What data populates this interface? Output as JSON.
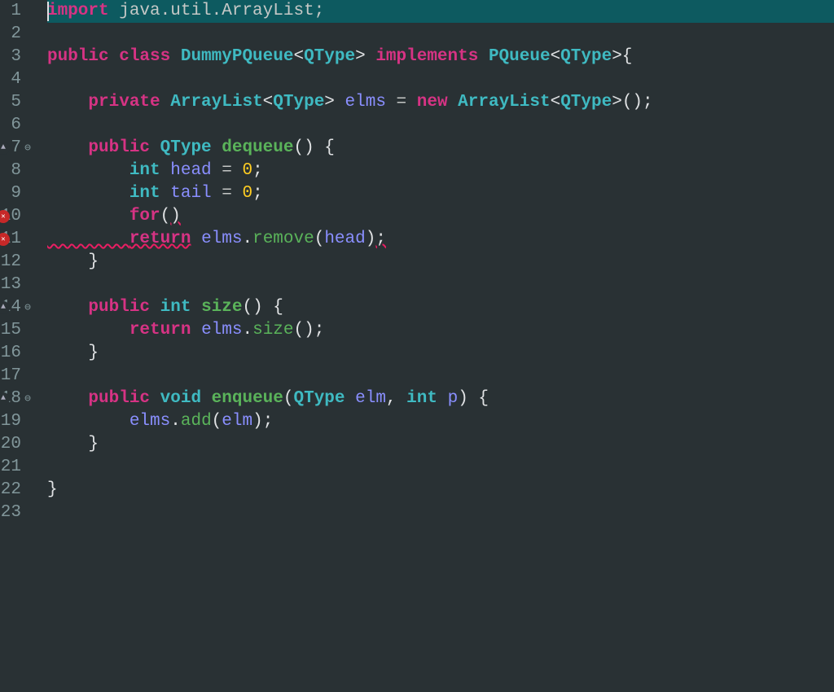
{
  "editor": {
    "lines": [
      {
        "num": "1",
        "fold": "",
        "marker": "",
        "current": true,
        "tokens": [
          {
            "cls": "kw-import",
            "t": "import"
          },
          {
            "cls": "dim",
            "t": " java.util.ArrayList;"
          }
        ]
      },
      {
        "num": "2",
        "fold": "",
        "marker": "",
        "tokens": []
      },
      {
        "num": "3",
        "fold": "",
        "marker": "",
        "tokens": [
          {
            "cls": "kw-modifier",
            "t": "public "
          },
          {
            "cls": "kw-class",
            "t": "class "
          },
          {
            "cls": "kw-classname",
            "t": "DummyPQueue"
          },
          {
            "cls": "angle",
            "t": "<"
          },
          {
            "cls": "kw-classname",
            "t": "QType"
          },
          {
            "cls": "angle",
            "t": ">"
          },
          {
            "cls": "dim",
            "t": " "
          },
          {
            "cls": "kw-implements",
            "t": "implements "
          },
          {
            "cls": "kw-classname",
            "t": "PQueue"
          },
          {
            "cls": "angle",
            "t": "<"
          },
          {
            "cls": "kw-classname",
            "t": "QType"
          },
          {
            "cls": "angle",
            "t": ">"
          },
          {
            "cls": "punct",
            "t": "{"
          }
        ]
      },
      {
        "num": "4",
        "fold": "",
        "marker": "",
        "tokens": []
      },
      {
        "num": "5",
        "fold": "",
        "marker": "",
        "tokens": [
          {
            "cls": "dim",
            "t": "    "
          },
          {
            "cls": "kw-modifier",
            "t": "private "
          },
          {
            "cls": "kw-classname",
            "t": "ArrayList"
          },
          {
            "cls": "angle",
            "t": "<"
          },
          {
            "cls": "kw-classname",
            "t": "QType"
          },
          {
            "cls": "angle",
            "t": ">"
          },
          {
            "cls": "dim",
            "t": " "
          },
          {
            "cls": "kw-var",
            "t": "elms"
          },
          {
            "cls": "dim",
            "t": " = "
          },
          {
            "cls": "kw-new",
            "t": "new "
          },
          {
            "cls": "kw-classname",
            "t": "ArrayList"
          },
          {
            "cls": "angle",
            "t": "<"
          },
          {
            "cls": "kw-classname",
            "t": "QType"
          },
          {
            "cls": "angle",
            "t": ">"
          },
          {
            "cls": "punct",
            "t": "();"
          }
        ]
      },
      {
        "num": "6",
        "fold": "",
        "marker": "",
        "tokens": []
      },
      {
        "num": "7",
        "fold": "⊖",
        "marker": "override",
        "tokens": [
          {
            "cls": "dim",
            "t": "    "
          },
          {
            "cls": "kw-modifier",
            "t": "public "
          },
          {
            "cls": "kw-classname",
            "t": "QType"
          },
          {
            "cls": "dim",
            "t": " "
          },
          {
            "cls": "kw-method",
            "t": "dequeue"
          },
          {
            "cls": "punct",
            "t": "() {"
          }
        ]
      },
      {
        "num": "8",
        "fold": "",
        "marker": "",
        "tokens": [
          {
            "cls": "dim",
            "t": "        "
          },
          {
            "cls": "kw-primtype",
            "t": "int"
          },
          {
            "cls": "dim",
            "t": " "
          },
          {
            "cls": "kw-var",
            "t": "head"
          },
          {
            "cls": "dim",
            "t": " = "
          },
          {
            "cls": "number",
            "t": "0"
          },
          {
            "cls": "punct",
            "t": ";"
          }
        ]
      },
      {
        "num": "9",
        "fold": "",
        "marker": "",
        "tokens": [
          {
            "cls": "dim",
            "t": "        "
          },
          {
            "cls": "kw-primtype",
            "t": "int"
          },
          {
            "cls": "dim",
            "t": " "
          },
          {
            "cls": "kw-var",
            "t": "tail"
          },
          {
            "cls": "dim",
            "t": " = "
          },
          {
            "cls": "number",
            "t": "0"
          },
          {
            "cls": "punct",
            "t": ";"
          }
        ]
      },
      {
        "num": "10",
        "fold": "",
        "marker": "error",
        "tokens": [
          {
            "cls": "dim",
            "t": "        "
          },
          {
            "cls": "kw-for",
            "t": "for"
          },
          {
            "cls": "punct",
            "t": "("
          },
          {
            "cls": "punct wavy",
            "t": ")"
          }
        ]
      },
      {
        "num": "11",
        "fold": "",
        "marker": "error",
        "tokens": [
          {
            "cls": "dim wavy",
            "t": "        "
          },
          {
            "cls": "kw-return wavy",
            "t": "return"
          },
          {
            "cls": "dim",
            "t": " "
          },
          {
            "cls": "kw-var",
            "t": "elms"
          },
          {
            "cls": "punct",
            "t": "."
          },
          {
            "cls": "kw-methodcall",
            "t": "remove"
          },
          {
            "cls": "punct",
            "t": "("
          },
          {
            "cls": "kw-var",
            "t": "head"
          },
          {
            "cls": "punct",
            "t": ")"
          },
          {
            "cls": "punct wavy",
            "t": ";"
          }
        ]
      },
      {
        "num": "12",
        "fold": "",
        "marker": "",
        "tokens": [
          {
            "cls": "dim",
            "t": "    "
          },
          {
            "cls": "punct",
            "t": "}"
          }
        ]
      },
      {
        "num": "13",
        "fold": "",
        "marker": "",
        "tokens": []
      },
      {
        "num": "14",
        "fold": "⊖",
        "marker": "override",
        "tokens": [
          {
            "cls": "dim",
            "t": "    "
          },
          {
            "cls": "kw-modifier",
            "t": "public "
          },
          {
            "cls": "kw-primtype",
            "t": "int"
          },
          {
            "cls": "dim",
            "t": " "
          },
          {
            "cls": "kw-method",
            "t": "size"
          },
          {
            "cls": "punct",
            "t": "() {"
          }
        ]
      },
      {
        "num": "15",
        "fold": "",
        "marker": "",
        "tokens": [
          {
            "cls": "dim",
            "t": "        "
          },
          {
            "cls": "kw-return",
            "t": "return"
          },
          {
            "cls": "dim",
            "t": " "
          },
          {
            "cls": "kw-var",
            "t": "elms"
          },
          {
            "cls": "punct",
            "t": "."
          },
          {
            "cls": "kw-methodcall",
            "t": "size"
          },
          {
            "cls": "punct",
            "t": "();"
          }
        ]
      },
      {
        "num": "16",
        "fold": "",
        "marker": "",
        "tokens": [
          {
            "cls": "dim",
            "t": "    "
          },
          {
            "cls": "punct",
            "t": "}"
          }
        ]
      },
      {
        "num": "17",
        "fold": "",
        "marker": "",
        "tokens": []
      },
      {
        "num": "18",
        "fold": "⊖",
        "marker": "override",
        "tokens": [
          {
            "cls": "dim",
            "t": "    "
          },
          {
            "cls": "kw-modifier",
            "t": "public "
          },
          {
            "cls": "kw-void",
            "t": "void"
          },
          {
            "cls": "dim",
            "t": " "
          },
          {
            "cls": "kw-method",
            "t": "enqueue"
          },
          {
            "cls": "punct",
            "t": "("
          },
          {
            "cls": "kw-classname",
            "t": "QType"
          },
          {
            "cls": "dim",
            "t": " "
          },
          {
            "cls": "kw-var",
            "t": "elm"
          },
          {
            "cls": "punct",
            "t": ", "
          },
          {
            "cls": "kw-primtype",
            "t": "int"
          },
          {
            "cls": "dim",
            "t": " "
          },
          {
            "cls": "kw-var",
            "t": "p"
          },
          {
            "cls": "punct",
            "t": ") {"
          }
        ]
      },
      {
        "num": "19",
        "fold": "",
        "marker": "",
        "tokens": [
          {
            "cls": "dim",
            "t": "        "
          },
          {
            "cls": "kw-var",
            "t": "elms"
          },
          {
            "cls": "punct",
            "t": "."
          },
          {
            "cls": "kw-methodcall",
            "t": "add"
          },
          {
            "cls": "punct",
            "t": "("
          },
          {
            "cls": "kw-var",
            "t": "elm"
          },
          {
            "cls": "punct",
            "t": ");"
          }
        ]
      },
      {
        "num": "20",
        "fold": "",
        "marker": "",
        "tokens": [
          {
            "cls": "dim",
            "t": "    "
          },
          {
            "cls": "punct",
            "t": "}"
          }
        ]
      },
      {
        "num": "21",
        "fold": "",
        "marker": "",
        "tokens": []
      },
      {
        "num": "22",
        "fold": "",
        "marker": "",
        "tokens": [
          {
            "cls": "punct",
            "t": "}"
          }
        ]
      },
      {
        "num": "23",
        "fold": "",
        "marker": "",
        "tokens": []
      }
    ]
  }
}
